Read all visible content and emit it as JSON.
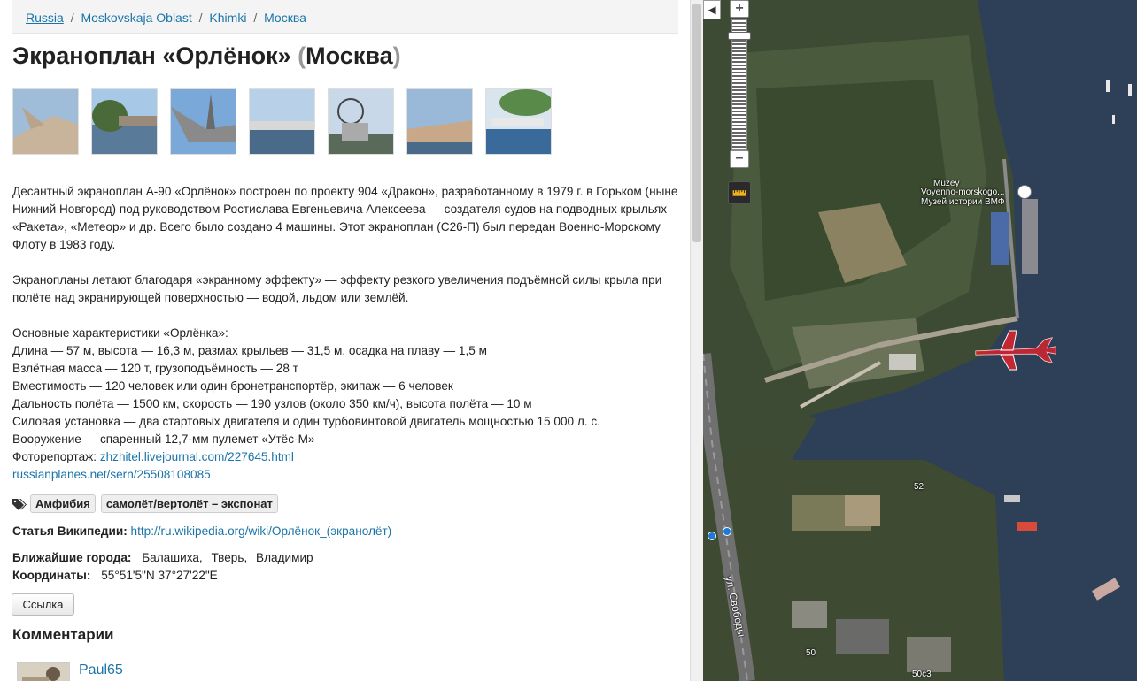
{
  "breadcrumb": {
    "items": [
      "Russia",
      "Moskovskaja Oblast",
      "Khimki",
      "Москва"
    ],
    "separator": "/"
  },
  "title": {
    "main": "Экраноплан «Орлёнок»",
    "open": "(",
    "city": "Москва",
    "close": ")"
  },
  "thumbnails": [
    "photo-1",
    "photo-2",
    "photo-3",
    "photo-4",
    "photo-5",
    "photo-6",
    "photo-7"
  ],
  "description": {
    "p1": "Десантный экраноплан А-90 «Орлёнок» построен по проекту 904 «Дракон», разработанному в 1979 г. в Горьком (ныне Нижний Новгород) под руководством Ростислава Евгеньевича Алексеева — создателя судов на подводных крыльях «Ракета», «Метеор» и др. Всего было создано 4 машины. Этот экраноплан (С26-П) был передан Военно-Морскому Флоту в 1983 году.",
    "p2": "Экранопланы летают благодаря «экранному эффекту» — эффекту резкого увеличения подъёмной силы крыла при полёте над экранирующей поверхностью — водой, льдом или землёй.",
    "specs_title": "Основные характеристики «Орлёнка»:",
    "specs": [
      "Длина — 57 м, высота — 16,3 м, размах крыльев — 31,5 м, осадка на плаву — 1,5 м",
      "Взлётная масса — 120 т, грузоподъёмность — 28 т",
      "Вместимость — 120 человек или один бронетранспортёр, экипаж — 6 человек",
      "Дальность полёта — 1500 км, скорость — 190 узлов (около 350 км/ч), высота полёта — 10 м",
      "Силовая установка — два стартовых двигателя и один турбовинтовой двигатель мощностью 15 000 л. с.",
      "Вооружение — спаренный 12,7-мм пулемет «Утёс-М»"
    ],
    "photo_label": "Фоторепортаж:",
    "photo_link": "zhzhitel.livejournal.com/227645.html",
    "second_link": "russianplanes.net/sern/25508108085"
  },
  "tags": [
    "Амфибия",
    "самолёт/вертолёт – экспонат"
  ],
  "wiki": {
    "label": "Статья Википедии:",
    "url": "http://ru.wikipedia.org/wiki/Орлёнок_(экранолёт)"
  },
  "nearby": {
    "label": "Ближайшие города:",
    "cities": [
      "Балашиха,",
      "Тверь,",
      "Владимир"
    ]
  },
  "coordinates": {
    "label": "Координаты:",
    "value": "55°51'5\"N 37°27'22\"E"
  },
  "link_button": "Ссылка",
  "comments": {
    "heading": "Комментарии",
    "first_user": "Paul65"
  },
  "map": {
    "collapse": "◀",
    "zoom_in": "+",
    "zoom_out": "−",
    "zoom_level_fraction": 0.1,
    "labels": {
      "museum_en1": "Muzey",
      "museum_en2": "Voyenno-morskogo...",
      "museum_ru": "Музей истории ВМФ",
      "street": "ул. Свободы",
      "num1": "52",
      "num2": "50",
      "num3": "50с3"
    },
    "marker_color": "#e8202a",
    "water_color": "#2b3d55"
  }
}
